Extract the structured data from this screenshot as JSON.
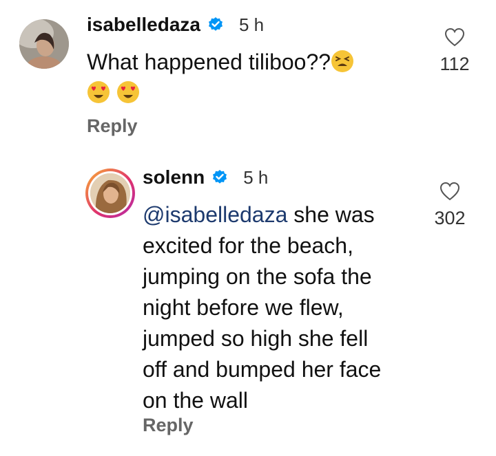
{
  "comments": [
    {
      "username": "isabelledaza",
      "time": "5 h",
      "text": "What happened tiliboo??",
      "emoji_tired": "tired-face-emoji",
      "emoji_heart_eyes": "smiling-face-with-heart-eyes-emoji",
      "reply_label": "Reply",
      "likes": "112"
    },
    {
      "username": "solenn",
      "time": "5 h",
      "mention": "@isabelledaza",
      "lines": [
        " she was",
        "excited for the beach,",
        "jumping on the sofa the",
        "night before we flew,",
        "jumped so high she fell",
        "off and bumped her face",
        "on the wall"
      ],
      "reply_label": "Reply",
      "likes": "302"
    }
  ],
  "colors": {
    "verified": "#0095f6",
    "mention": "#1d3a6e"
  }
}
